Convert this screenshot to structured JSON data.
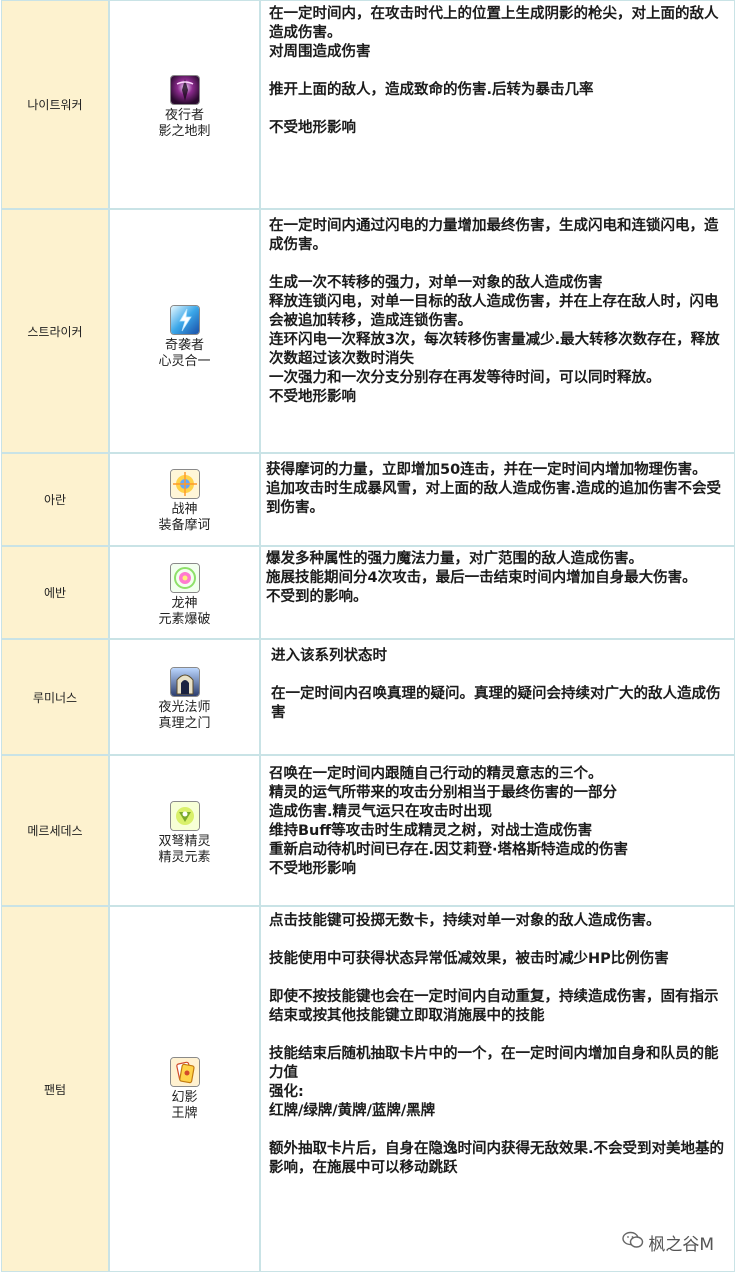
{
  "rows": [
    {
      "class_kr": "나이트워커",
      "icon": "nightwalker-skill-icon",
      "skill": [
        "夜行者",
        "影之地刺"
      ],
      "desc": [
        "在一定时间内，在攻击时代上的位置上生成阴影的枪尖，对上面的敌人造成伤害。",
        "对周围造成伤害",
        "",
        "推开上面的敌人，造成致命的伤害.后转为暴击几率",
        "",
        "不受地形影响"
      ]
    },
    {
      "class_kr": "스트라이커",
      "icon": "striker-skill-icon",
      "skill": [
        "奇袭者",
        "心灵合一"
      ],
      "desc": [
        "在一定时间内通过闪电的力量增加最终伤害，生成闪电和连锁闪电，造成伤害。",
        "",
        "生成一次不转移的强力，对单一对象的敌人造成伤害",
        "释放连锁闪电，对单一目标的敌人造成伤害，并在上存在敌人时，闪电会被追加转移，造成连锁伤害。",
        "连环闪电一次释放3次，每次转移伤害量减少.最大转移次数存在，释放次数超过该次数时消失",
        "一次强力和一次分支分别存在再发等待时间，可以同时释放。",
        "不受地形影响"
      ]
    },
    {
      "class_kr": "아란",
      "icon": "aran-skill-icon",
      "skill": [
        "战神",
        "装备摩诃"
      ],
      "desc": [
        "获得摩诃的力量，立即增加50连击，并在一定时间内增加物理伤害。",
        "追加攻击时生成暴风雪，对上面的敌人造成伤害.造成的追加伤害不会受到伤害。"
      ]
    },
    {
      "class_kr": "에반",
      "icon": "evan-skill-icon",
      "skill": [
        "龙神",
        "元素爆破"
      ],
      "desc": [
        "爆发多种属性的强力魔法力量，对广范围的敌人造成伤害。",
        "施展技能期间分4次攻击，最后一击结束时间内增加自身最大伤害。",
        "不受到的影响。"
      ]
    },
    {
      "class_kr": "루미너스",
      "icon": "luminous-skill-icon",
      "skill": [
        "夜光法师",
        "真理之门"
      ],
      "desc": [
        "进入该系列状态时",
        "",
        "在一定时间内召唤真理的疑问。真理的疑问会持续对广大的敌人造成伤害"
      ]
    },
    {
      "class_kr": "메르세데스",
      "icon": "mercedes-skill-icon",
      "skill": [
        "双弩精灵",
        "精灵元素"
      ],
      "desc": [
        "召唤在一定时间内跟随自己行动的精灵意志的三个。",
        "精灵的运气所带来的攻击分别相当于最终伤害的一部分",
        "造成伤害.精灵气运只在攻击时出现",
        "维持Buff等攻击时生成精灵之树，对战士造成伤害",
        "重新启动待机时间已存在.因艾莉登·塔格斯特造成的伤害",
        "不受地形影响"
      ]
    },
    {
      "class_kr": "팬텀",
      "icon": "phantom-skill-icon",
      "skill": [
        "幻影",
        "王牌"
      ],
      "desc": [
        "点击技能键可投掷无数卡，持续对单一对象的敌人造成伤害。",
        "",
        "技能使用中可获得状态异常低减效果，被击时减少HP比例伤害",
        "",
        "即使不按技能键也会在一定时间内自动重复，持续造成伤害，固有指示结束或按其他技能键立即取消施展中的技能",
        "",
        "技能结束后随机抽取卡片中的一个，在一定时间内增加自身和队员的能力值",
        "强化:",
        "红牌/绿牌/黄牌/蓝牌/黑牌",
        "",
        "额外抽取卡片后，自身在隐逸时间内获得无敌效果.不会受到对美地基的影响，在施展中可以移动跳跃"
      ]
    }
  ],
  "watermark": {
    "icon": "wechat-icon",
    "text": "枫之谷M"
  }
}
